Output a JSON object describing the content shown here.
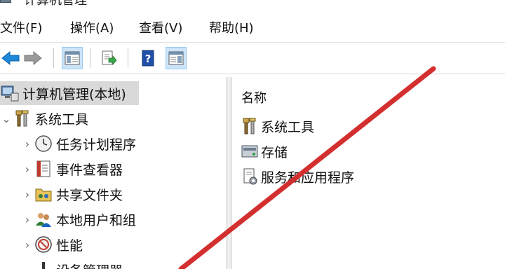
{
  "window": {
    "title": "计算机管理"
  },
  "menu": [
    {
      "label": "文件(F)"
    },
    {
      "label": "操作(A)"
    },
    {
      "label": "查看(V)"
    },
    {
      "label": "帮助(H)"
    }
  ],
  "toolbar": {
    "buttons": [
      {
        "icon": "back-arrow-icon"
      },
      {
        "icon": "forward-arrow-icon"
      },
      {
        "icon": "show-hide-console-tree-icon",
        "active": true
      },
      {
        "icon": "export-list-icon"
      },
      {
        "icon": "help-icon"
      },
      {
        "icon": "show-hide-action-pane-icon",
        "active": true
      }
    ]
  },
  "tree": {
    "root": {
      "label": "计算机管理(本地)",
      "icon": "computer-management-icon"
    },
    "items": [
      {
        "label": "系统工具",
        "icon": "tools-icon",
        "expanded": true
      },
      {
        "label": "任务计划程序",
        "icon": "clock-icon"
      },
      {
        "label": "事件查看器",
        "icon": "event-viewer-icon"
      },
      {
        "label": "共享文件夹",
        "icon": "shared-folder-icon"
      },
      {
        "label": "本地用户和组",
        "icon": "users-icon"
      },
      {
        "label": "性能",
        "icon": "performance-icon"
      },
      {
        "label": "设备管理器",
        "icon": "device-manager-icon"
      }
    ]
  },
  "list": {
    "header": "名称",
    "items": [
      {
        "label": "系统工具",
        "icon": "tools-icon"
      },
      {
        "label": "存储",
        "icon": "storage-icon"
      },
      {
        "label": "服务和应用程序",
        "icon": "services-icon"
      }
    ]
  },
  "colors": {
    "accent_red": "#d32f2f",
    "selection": "#d9d9d9",
    "toolbar_active": "#cce4f7"
  }
}
